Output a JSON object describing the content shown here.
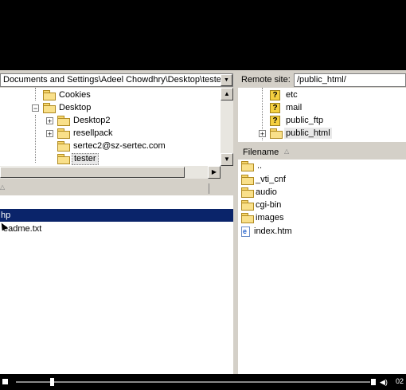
{
  "local": {
    "path": "Documents and Settings\\Adeel Chowdhry\\Desktop\\tester\\",
    "tree": [
      {
        "label": "Cookies"
      },
      {
        "label": "Desktop"
      },
      {
        "label": "Desktop2"
      },
      {
        "label": "resellpack"
      },
      {
        "label": "sertec2@sz-sertec.com"
      },
      {
        "label": "tester"
      }
    ],
    "files": [
      {
        "label": "hp"
      },
      {
        "label": "eadme.txt"
      }
    ]
  },
  "remote": {
    "site_label": "Remote site:",
    "path": "/public_html/",
    "tree": [
      {
        "label": "etc"
      },
      {
        "label": "mail"
      },
      {
        "label": "public_ftp"
      },
      {
        "label": "public_html"
      }
    ],
    "column_filename": "Filename",
    "files": [
      {
        "label": ".."
      },
      {
        "label": "_vti_cnf"
      },
      {
        "label": "audio"
      },
      {
        "label": "cgi-bin"
      },
      {
        "label": "images"
      },
      {
        "label": "index.htm"
      }
    ]
  },
  "player": {
    "time": "02",
    "progress": 0.1
  }
}
